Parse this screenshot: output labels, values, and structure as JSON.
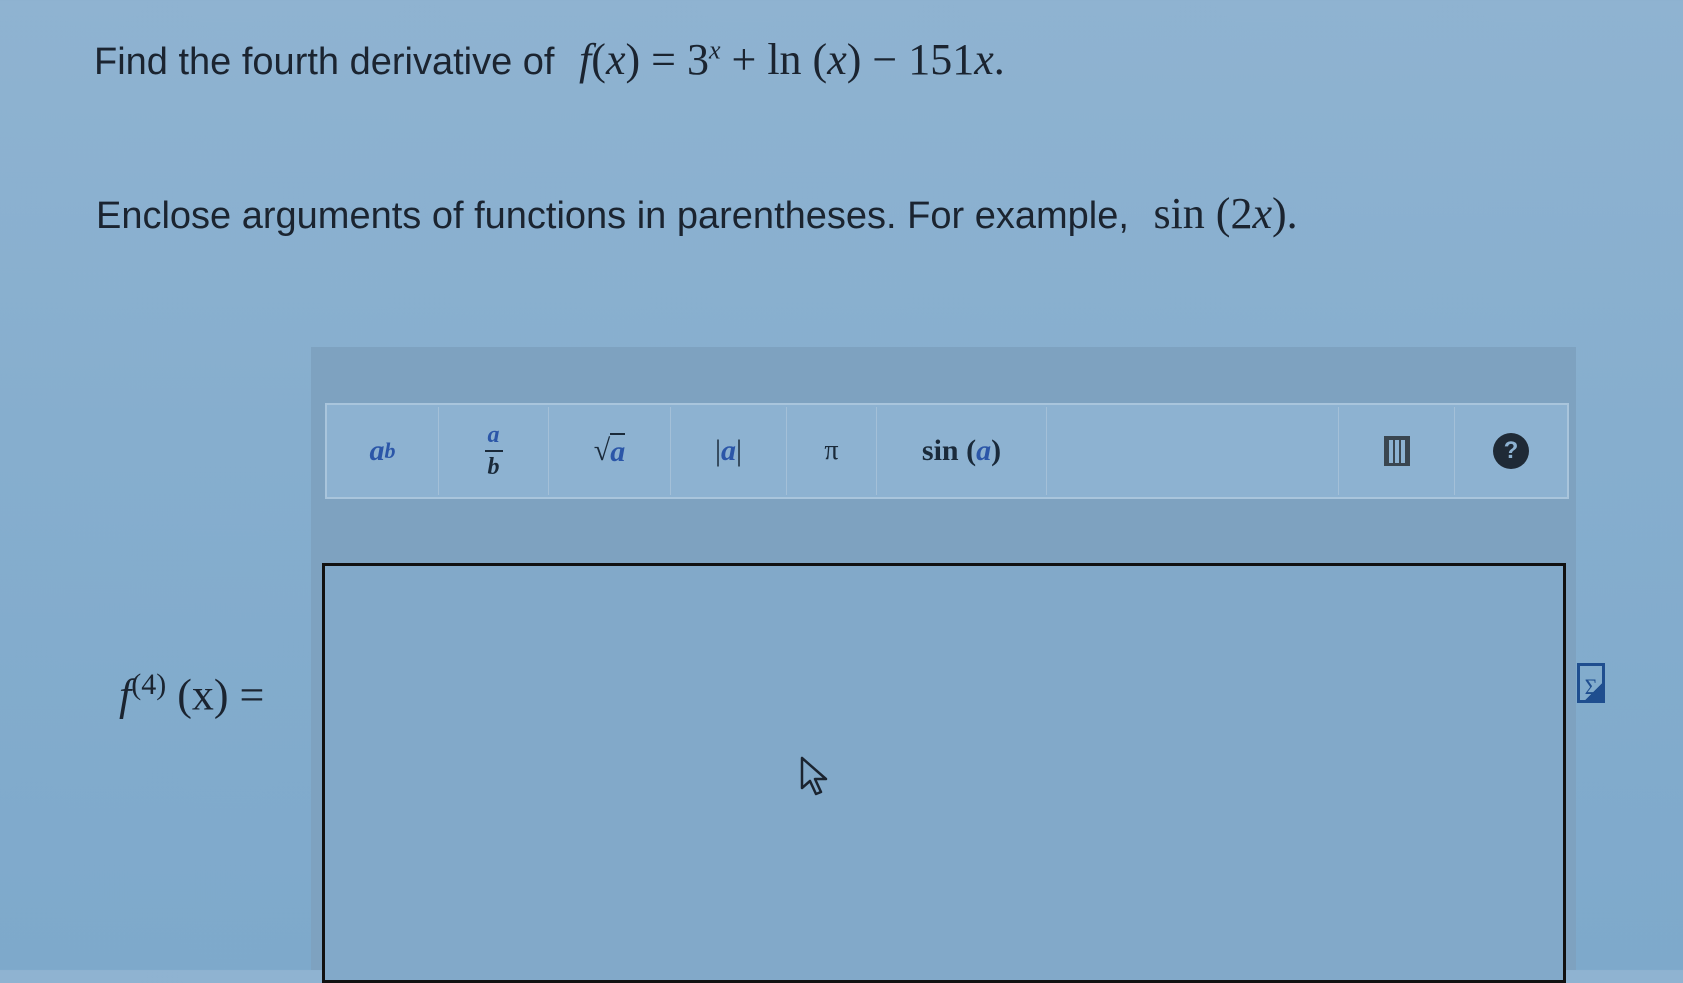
{
  "question": {
    "prefix": "Find the fourth derivative of",
    "f_name": "f",
    "arg_open": "(",
    "arg_var": "x",
    "arg_close": ")",
    "equals": " = 3",
    "exp_var": "x",
    "rest": " + ln (",
    "rest_var": "x",
    "rest_tail": ") − 151",
    "tail_var": "x",
    "end": "."
  },
  "instruction": {
    "text": "Enclose arguments of functions in parentheses. For example,",
    "example": "sin (2",
    "example_var": "x",
    "example_end": ")."
  },
  "toolbar": {
    "power": {
      "base": "a",
      "exp": "b"
    },
    "fraction": {
      "num": "a",
      "den": "b"
    },
    "sqrt": {
      "symbol": "√",
      "arg": "a"
    },
    "abs": {
      "left": "|",
      "arg": "a",
      "right": "|"
    },
    "pi": "π",
    "sin": {
      "name": "sin (",
      "arg": "a",
      "close": ")"
    },
    "help": "?",
    "icons": {
      "trash": "trash-icon",
      "help": "help-icon"
    }
  },
  "answer": {
    "lhs_f": "f",
    "lhs_order": "(4)",
    "lhs_arg": " (x)",
    "lhs_eq": " =",
    "value": ""
  },
  "sigma_icon": "Σ",
  "colors": {
    "background": "#86aece",
    "accent": "#2b56a8"
  }
}
